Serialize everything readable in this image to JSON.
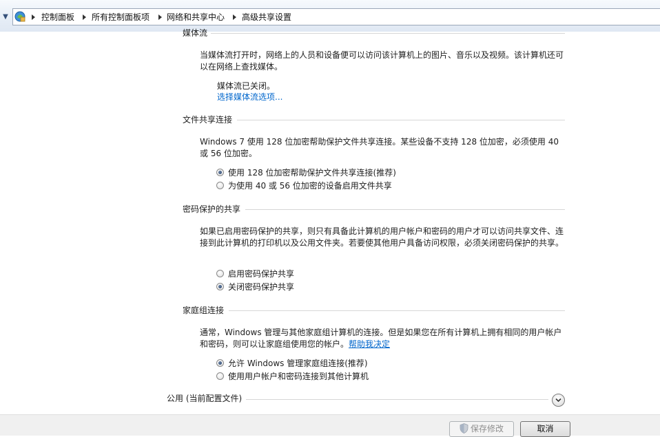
{
  "breadcrumb": {
    "items": [
      "控制面板",
      "所有控制面板项",
      "网络和共享中心",
      "高级共享设置"
    ]
  },
  "sections": {
    "media": {
      "header": "媒体流",
      "description": "当媒体流打开时，网络上的人员和设备便可以访问该计算机上的图片、音乐以及视频。该计算机还可以在网络上查找媒体。",
      "status": "媒体流已关闭。",
      "link": "选择媒体流选项..."
    },
    "file_sharing": {
      "header": "文件共享连接",
      "description": "Windows 7 使用 128 位加密帮助保护文件共享连接。某些设备不支持 128 位加密，必须使用 40 或 56 位加密。",
      "options": [
        "使用 128 位加密帮助保护文件共享连接(推荐)",
        "为使用 40 或 56 位加密的设备启用文件共享"
      ],
      "selected": 0
    },
    "password": {
      "header": "密码保护的共享",
      "description": "如果已启用密码保护的共享，则只有具备此计算机的用户帐户和密码的用户才可以访问共享文件、连接到此计算机的打印机以及公用文件夹。若要使其他用户具备访问权限，必须关闭密码保护的共享。",
      "options": [
        "启用密码保护共享",
        "关闭密码保护共享"
      ],
      "selected": 1
    },
    "homegroup": {
      "header": "家庭组连接",
      "description": "通常，Windows 管理与其他家庭组计算机的连接。但是如果您在所有计算机上拥有相同的用户帐户和密码，则可以让家庭组使用您的帐户。",
      "help_link": "帮助我决定",
      "options": [
        "允许 Windows 管理家庭组连接(推荐)",
        "使用用户帐户和密码连接到其他计算机"
      ],
      "selected": 0
    },
    "public": {
      "header": "公用 (当前配置文件)"
    }
  },
  "footer": {
    "save_label": "保存修改",
    "cancel_label": "取消"
  },
  "icons": {
    "control_panel": "control-panel-icon",
    "shield": "uac-shield-icon",
    "expand": "chevron-down-icon"
  },
  "colors": {
    "link": "#0066cc",
    "radio_selected": "#1f3a63"
  }
}
